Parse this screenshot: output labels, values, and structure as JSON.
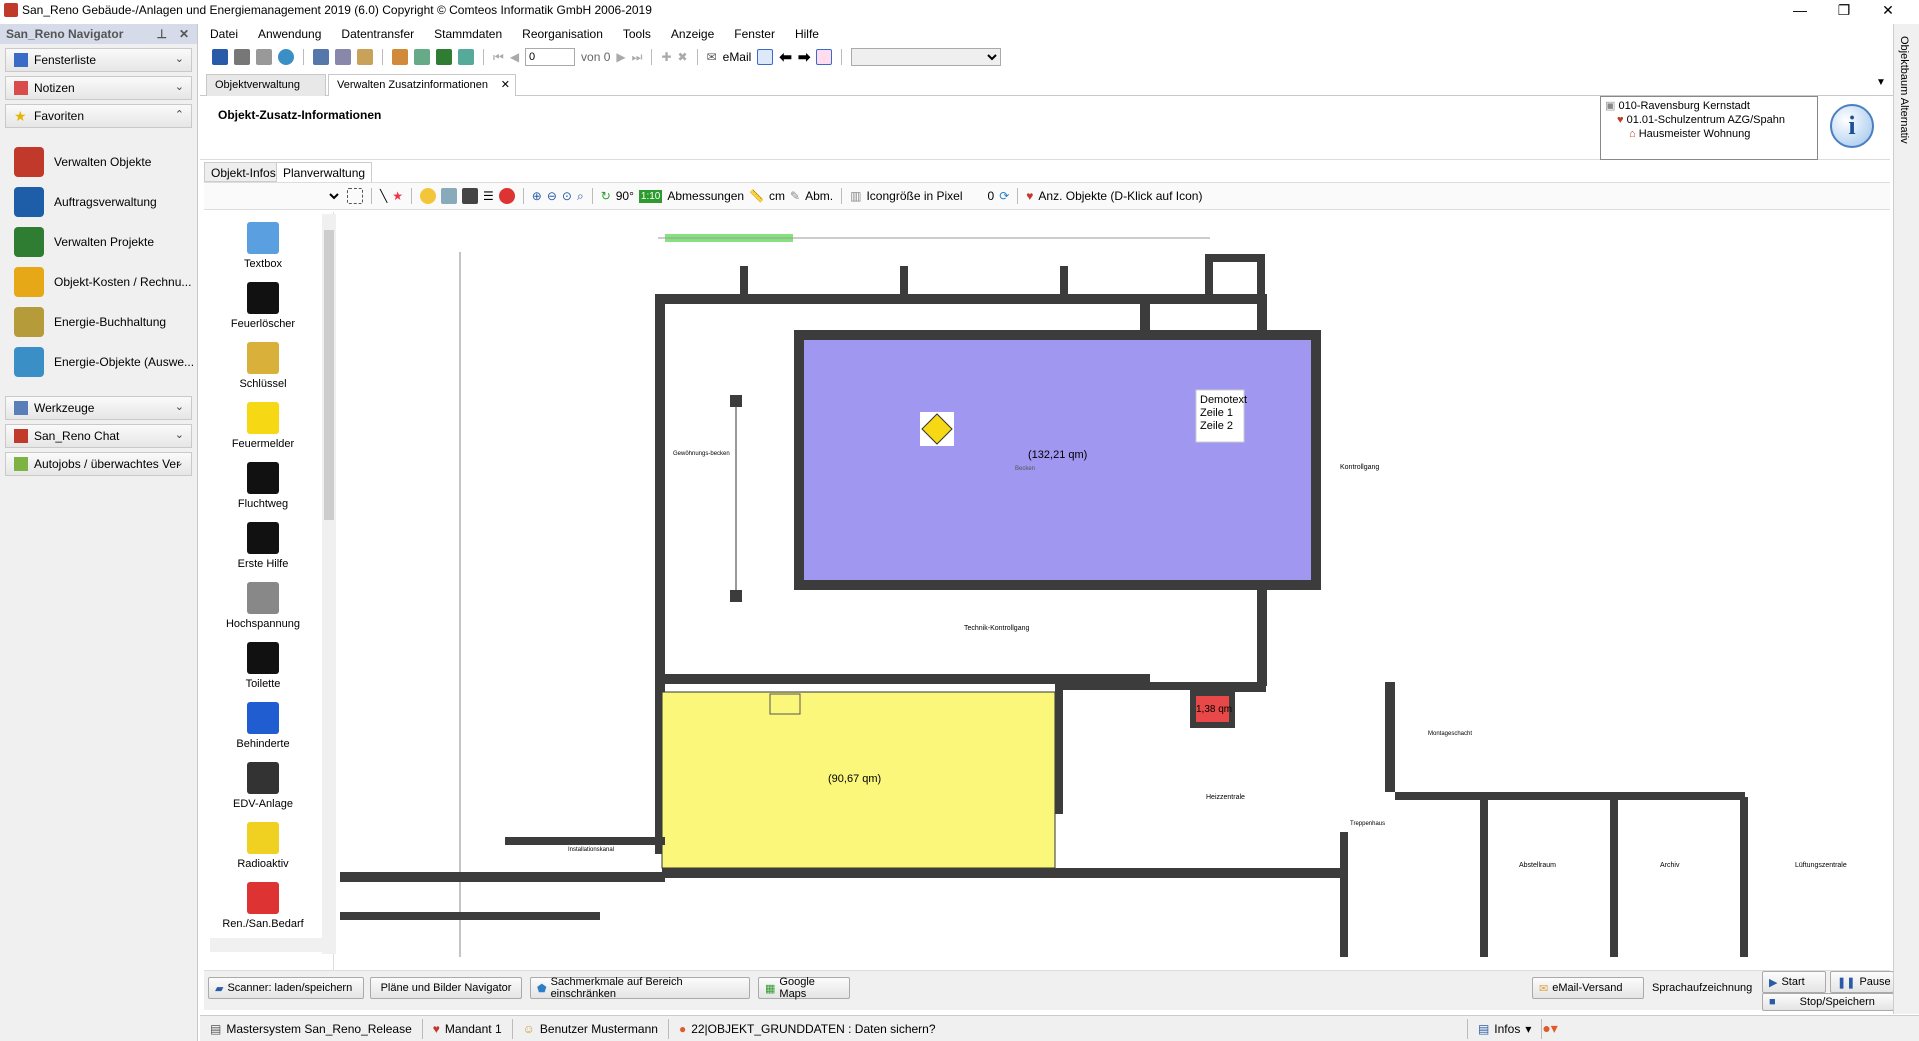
{
  "window": {
    "title": "San_Reno Gebäude-/Anlagen und Energiemanagement 2019 (6.0)   Copyright © Comteos Informatik GmbH 2006-2019",
    "minimize": "—",
    "maximize": "❐",
    "close": "✕"
  },
  "navigator": {
    "title": "San_Reno Navigator",
    "pin": "⊥",
    "close": "✕",
    "sections": [
      {
        "label": "Fensterliste",
        "icon": "window-list-icon"
      },
      {
        "label": "Notizen",
        "icon": "notes-icon"
      },
      {
        "label": "Favoriten",
        "icon": "star-icon"
      }
    ],
    "favorites": [
      {
        "label": "Verwalten Objekte",
        "icon": "objects-icon",
        "color": "#c0392b"
      },
      {
        "label": "Auftragsverwaltung",
        "icon": "orders-icon",
        "color": "#1e5ea8"
      },
      {
        "label": "Verwalten Projekte",
        "icon": "projects-icon",
        "color": "#2e7d32"
      },
      {
        "label": "Objekt-Kosten / Rechnu...",
        "icon": "costs-icon",
        "color": "#e6a817"
      },
      {
        "label": "Energie-Buchhaltung",
        "icon": "energy-accounting-icon",
        "color": "#b59b3a"
      },
      {
        "label": "Energie-Objekte (Auswe...",
        "icon": "energy-objects-icon",
        "color": "#3a8fc7"
      }
    ],
    "lower_sections": [
      {
        "label": "Werkzeuge",
        "icon": "tools-icon"
      },
      {
        "label": "San_Reno Chat",
        "icon": "chat-icon"
      },
      {
        "label": "Autojobs / überwachtes Ver",
        "icon": "autojobs-icon"
      }
    ]
  },
  "menu": [
    "Datei",
    "Anwendung",
    "Datentransfer",
    "Stammdaten",
    "Reorganisation",
    "Tools",
    "Anzeige",
    "Fenster",
    "Hilfe"
  ],
  "toolbar": {
    "record_value": "0",
    "record_of": "von 0",
    "email": "eMail",
    "combo_value": ""
  },
  "tabs": [
    {
      "label": "Objektverwaltung"
    },
    {
      "label": "Verwalten Zusatzinformationen",
      "close": "✕"
    }
  ],
  "panel": {
    "title": "Objekt-Zusatz-Informationen",
    "tree": [
      "010-Ravensburg Kernstadt",
      "01.01-Schulzentrum AZG/Spahn",
      "Hausmeister Wohnung"
    ],
    "info_glyph": "i"
  },
  "subtabs": [
    "Objekt-Infos",
    "Planverwaltung"
  ],
  "plan_toolbar": {
    "rotate": "90°",
    "scale": "1:10",
    "dimensions": "Abmessungen",
    "unit": "cm",
    "abbr": "Abm.",
    "icon_size_label": "Icongröße in Pixel",
    "icon_size_value": "0",
    "show_objects": "Anz. Objekte (D-Klick auf Icon)"
  },
  "palette": [
    {
      "label": "Textbox",
      "icon": "textbox-icon"
    },
    {
      "label": "Feuerlöscher",
      "icon": "fire-extinguisher-icon"
    },
    {
      "label": "Schlüssel",
      "icon": "key-icon"
    },
    {
      "label": "Feuermelder",
      "icon": "fire-alarm-icon"
    },
    {
      "label": "Fluchtweg",
      "icon": "escape-route-icon"
    },
    {
      "label": "Erste Hilfe",
      "icon": "first-aid-icon"
    },
    {
      "label": "Hochspannung",
      "icon": "high-voltage-icon"
    },
    {
      "label": "Toilette",
      "icon": "toilet-icon"
    },
    {
      "label": "Behinderte",
      "icon": "wheelchair-icon"
    },
    {
      "label": "EDV-Anlage",
      "icon": "computer-icon"
    },
    {
      "label": "Radioaktiv",
      "icon": "radioactive-icon"
    },
    {
      "label": "Ren./San.Bedarf",
      "icon": "warning-triangle-icon"
    }
  ],
  "plan": {
    "pool_area": "(132,21 qm)",
    "pool_label": "Becken",
    "demotext": [
      "Demotext",
      "Zeile 1",
      "Zeile 2"
    ],
    "yellow_area": "(90,67 qm)",
    "red_area": "1,38 qm",
    "rooms": [
      "Kontrollgang",
      "Technik-Kontrollgang",
      "Gewöhnungs-becken",
      "Heizzentrale",
      "Installationskanal",
      "Abstellraum",
      "Archiv",
      "Lüftungszentrale",
      "Treppenhaus",
      "Montageschacht"
    ],
    "colors": {
      "pool": "#9f97f0",
      "yellow": "#fbf77a",
      "red": "#e84848",
      "green": "#86e27e",
      "wall": "#3c3c3c"
    }
  },
  "bottom_buttons": [
    {
      "label": "Scanner: laden/speichern"
    },
    {
      "label": "Pläne und Bilder Navigator"
    },
    {
      "label": "Sachmerkmale auf Bereich einschränken"
    },
    {
      "label": "Google Maps"
    }
  ],
  "speech": {
    "email_send": "eMail-Versand",
    "label": "Sprachaufzeichnung",
    "start": "Start",
    "pause": "Pause",
    "stop": "Stop/Speichern"
  },
  "status": {
    "system": "Mastersystem San_Reno_Release",
    "mandant": "Mandant 1",
    "user": "Benutzer Mustermann",
    "message": "22|OBJEKT_GRUNDDATEN : Daten sichern?",
    "infos": "Infos"
  },
  "right_strip": "Objektbaum Alternativ"
}
